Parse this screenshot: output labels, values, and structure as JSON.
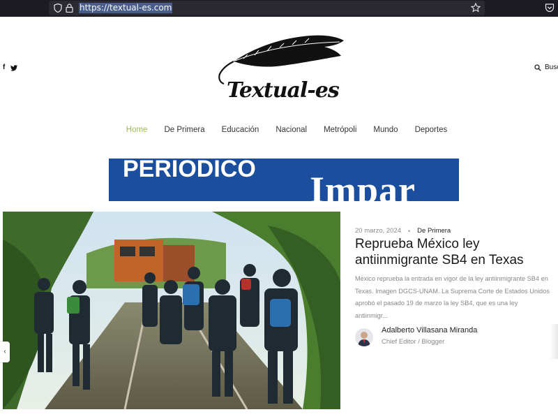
{
  "browser": {
    "url": "https://textual-es.com",
    "icons": [
      "shield-icon",
      "lock-icon",
      "star-icon",
      "pocket-icon"
    ]
  },
  "header": {
    "social": [
      {
        "icon": "facebook-icon",
        "glyph": "f"
      },
      {
        "icon": "twitter-icon",
        "glyph": "🐦"
      }
    ],
    "logo_text": "Textual-es",
    "search_label": "Busc"
  },
  "nav": {
    "items": [
      "Home",
      "De Primera",
      "Educación",
      "Nacional",
      "Metrópoli",
      "Mundo",
      "Deportes"
    ],
    "active": "Home",
    "active_color": "#9bba5a"
  },
  "banner": {
    "line1": "PERIODICO",
    "line2": "Impar",
    "background": "#1b4f9e"
  },
  "article": {
    "date": "20 marzo, 2024",
    "category": "De Primera",
    "title": "Reprueba México ley antiinmigrante SB4 en Texas",
    "excerpt": "México reprueba la entrada en vigor de la ley antiinmigrante SB4 en Texas. Imagen DGCS-UNAM. La Suprema Corte de Estados Unidos aprobó el pasado 19 de marzo la ley SB4, que es una ley antiinmigr...",
    "author_name": "Adalberto Villasana Miranda",
    "author_role": "Chief Editor / Blogger"
  }
}
